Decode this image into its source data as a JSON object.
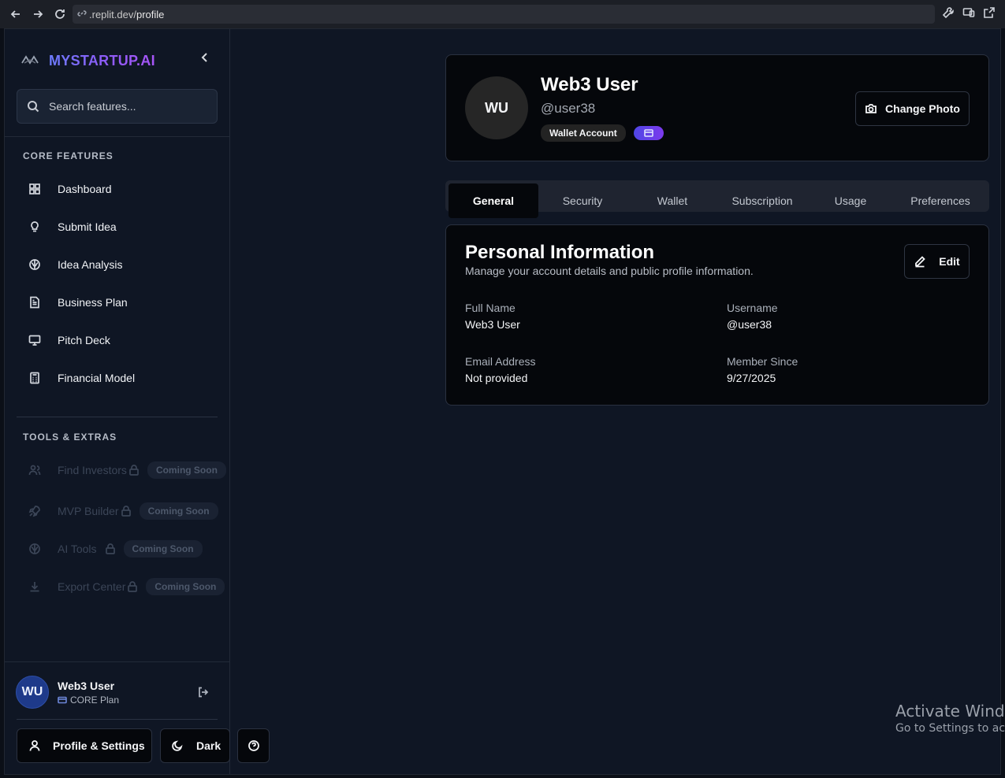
{
  "browser": {
    "url_prefix": ".replit.dev/",
    "url_path": "profile"
  },
  "sidebar": {
    "brand": "MYSTARTUP.AI",
    "search_placeholder": "Search features...",
    "core_title": "CORE FEATURES",
    "core_items": [
      {
        "label": "Dashboard",
        "icon": "dashboard-icon"
      },
      {
        "label": "Submit Idea",
        "icon": "lightbulb-icon"
      },
      {
        "label": "Idea Analysis",
        "icon": "brain-icon"
      },
      {
        "label": "Business Plan",
        "icon": "document-icon"
      },
      {
        "label": "Pitch Deck",
        "icon": "presentation-icon"
      },
      {
        "label": "Financial Model",
        "icon": "calculator-icon"
      }
    ],
    "tools_title": "TOOLS & EXTRAS",
    "tools": [
      {
        "label": "Find Investors",
        "badge": "Coming Soon",
        "icon": "users-icon"
      },
      {
        "label": "MVP Builder",
        "badge": "Coming Soon",
        "icon": "rocket-icon"
      },
      {
        "label": "AI Tools",
        "badge": "Coming Soon",
        "icon": "brain-icon"
      },
      {
        "label": "Export Center",
        "badge": "Coming Soon",
        "icon": "download-icon"
      }
    ],
    "user": {
      "initials": "WU",
      "name": "Web3 User",
      "plan": "CORE Plan"
    },
    "profile_button": "Profile & Settings",
    "theme_button": "Dark"
  },
  "profile": {
    "initials": "WU",
    "name": "Web3 User",
    "handle": "@user38",
    "badge": "Wallet Account",
    "change_photo": "Change Photo"
  },
  "tabs": [
    "General",
    "Security",
    "Wallet",
    "Subscription",
    "Usage",
    "Preferences"
  ],
  "active_tab": "General",
  "personal": {
    "title": "Personal Information",
    "subtitle": "Manage your account details and public profile information.",
    "edit_label": "Edit",
    "fields": [
      {
        "label": "Full Name",
        "value": "Web3 User"
      },
      {
        "label": "Username",
        "value": "@user38"
      },
      {
        "label": "Email Address",
        "value": "Not provided"
      },
      {
        "label": "Member Since",
        "value": "9/27/2025"
      }
    ]
  },
  "watermark": {
    "line1": "Activate Windo",
    "line2": "Go to Settings to act"
  },
  "colors": {
    "background": "#0f1624",
    "card": "#05070b",
    "accent": "#7c3aed",
    "avatar": "#1e3a8a"
  }
}
